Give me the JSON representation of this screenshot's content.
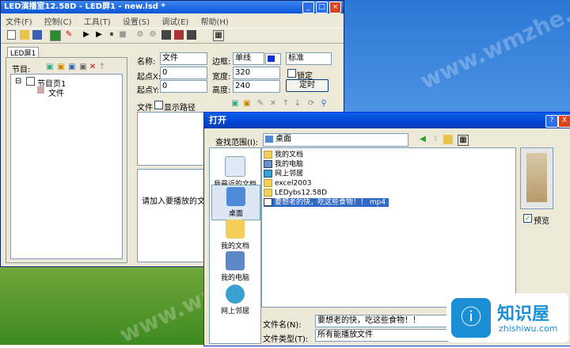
{
  "main_window": {
    "title": "LED演播室12.58D - LED屏1 - new.lsd *",
    "menu": [
      "文件(F)",
      "控制(C)",
      "工具(T)",
      "设置(S)",
      "调试(E)",
      "帮助(H)"
    ],
    "tab": "LED屏1",
    "program_label": "节目:",
    "tree": {
      "page": "节目页1",
      "file": "文件"
    },
    "name_label": "名称:",
    "name_value": "文件",
    "border_label": "边框:",
    "border_value": "单线",
    "style_value": "标准",
    "startx_label": "起点X:",
    "startx_value": "0",
    "width_label": "宽度:",
    "width_value": "320",
    "lock_label": "锁定",
    "starty_label": "起点Y:",
    "starty_value": "0",
    "height_label": "高度:",
    "height_value": "240",
    "timer_button": "定时",
    "file_label": "文件",
    "show_path_label": "显示路径",
    "hint": "请加入要播放的文件。"
  },
  "dialog": {
    "title": "打开",
    "help": "?",
    "close": "X",
    "lookin_label": "查找范围(I):",
    "lookin_value": "桌面",
    "places": [
      "我最近的文档",
      "桌面",
      "我的文档",
      "我的电脑",
      "网上邻居"
    ],
    "files": [
      "我的文档",
      "我的电脑",
      "网上邻居",
      "excel2003",
      "LEDybs12.58D",
      "要想老的快，吃这些食物！！ mp4"
    ],
    "preview_label": "预览",
    "filename_label": "文件名(N):",
    "filename_value": "要想老的快，吃这些食物！！",
    "filetype_label": "文件类型(T):",
    "filetype_value": "所有能播放文件"
  },
  "branding": {
    "name": "知识屋",
    "url": "zhishiwu.com",
    "watermark": "www.wmzhe.com"
  },
  "colors": {
    "accent": "#0a54d8",
    "selection": "#316ac5",
    "brand": "#1a8fd6"
  }
}
